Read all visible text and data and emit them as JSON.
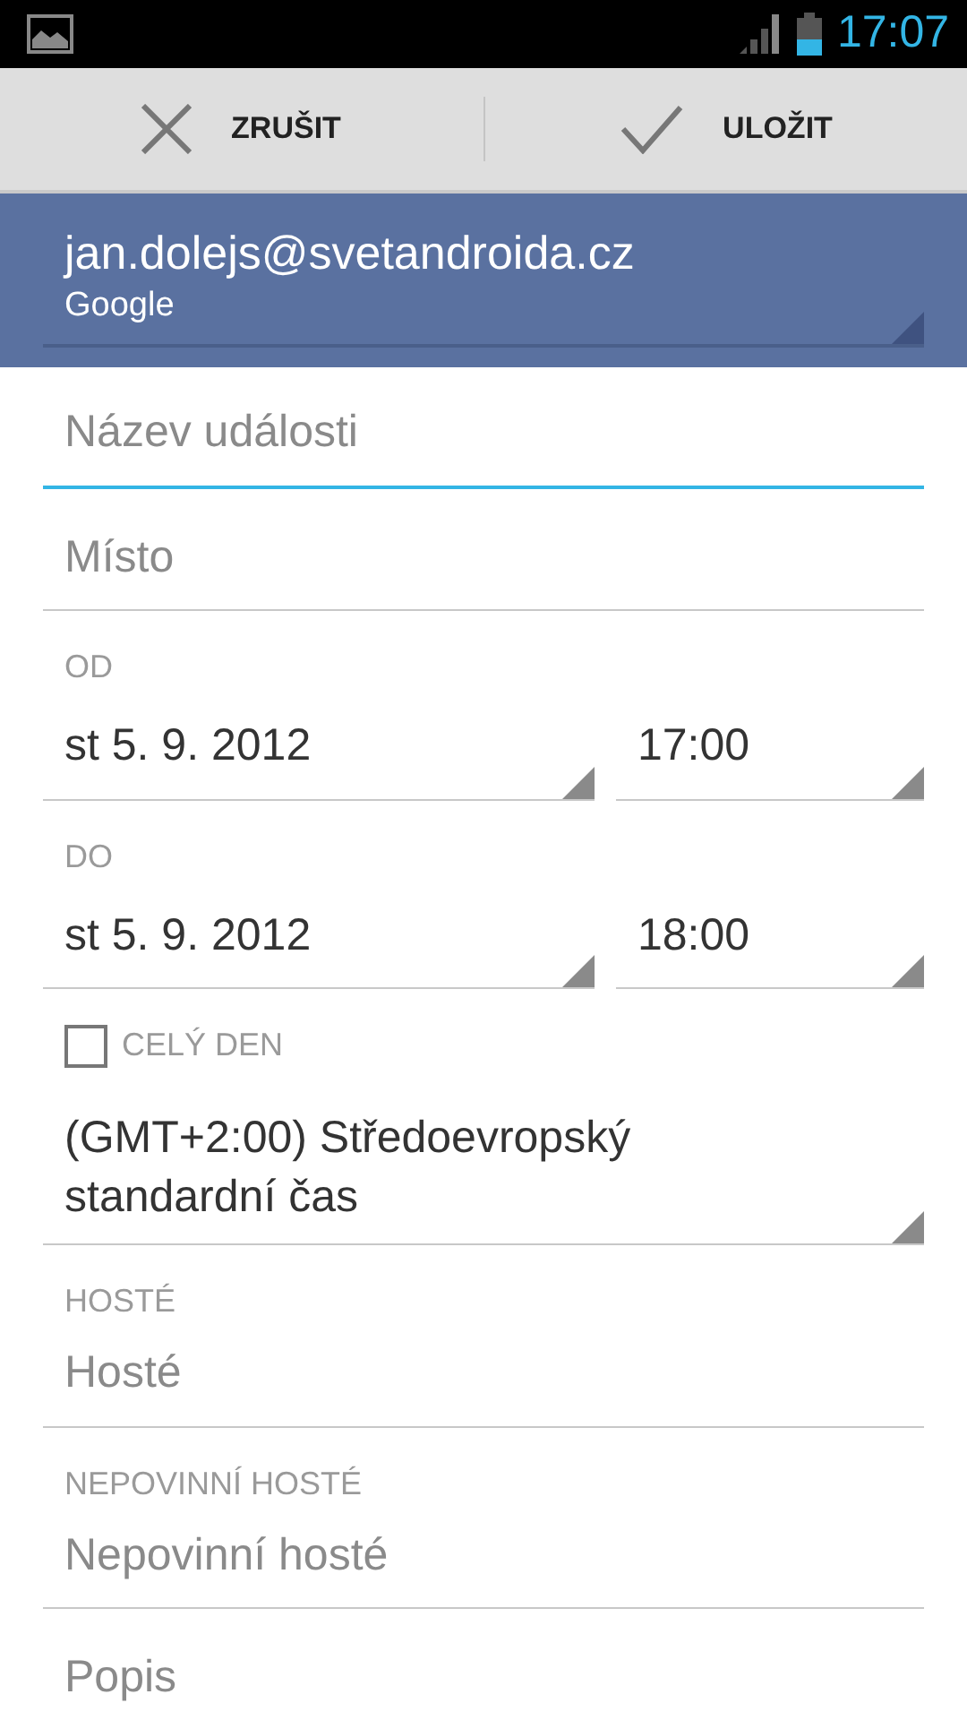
{
  "status_bar": {
    "time": "17:07"
  },
  "action_bar": {
    "buttons": [
      {
        "kind": "cancel",
        "label": "ZRUŠIT"
      },
      {
        "kind": "save",
        "label": "ULOŽIT"
      }
    ]
  },
  "account": {
    "email": "jan.dolejs@svetandroida.cz",
    "type": "Google"
  },
  "fields": [
    {
      "kind": "text",
      "placeholder": "Název události",
      "focused": true
    },
    {
      "kind": "text",
      "placeholder": "Místo",
      "focused": false
    },
    {
      "kind": "datetime",
      "label": "OD",
      "date": "st 5. 9. 2012",
      "time": "17:00"
    },
    {
      "kind": "datetime",
      "label": "DO",
      "date": "st 5. 9. 2012",
      "time": "18:00"
    },
    {
      "kind": "checkbox",
      "label": "CELÝ DEN",
      "checked": false
    },
    {
      "kind": "spinner",
      "value": "(GMT+2:00) Středoevropský standardní čas"
    },
    {
      "kind": "text",
      "label": "HOSTÉ",
      "placeholder": "Hosté",
      "focused": false
    },
    {
      "kind": "text",
      "label": "NEPOVINNÍ HOSTÉ",
      "placeholder": "Nepovinní hosté",
      "focused": false
    },
    {
      "kind": "text",
      "placeholder": "Popis",
      "focused": false
    }
  ]
}
